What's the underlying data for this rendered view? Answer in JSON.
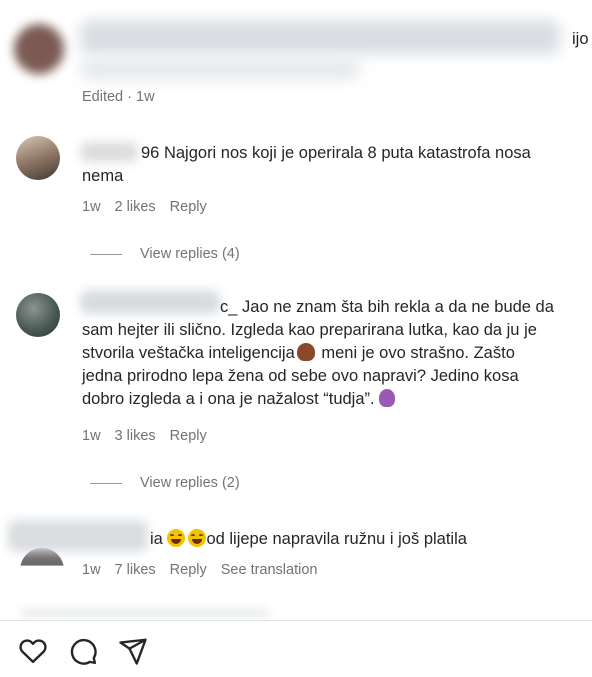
{
  "top_comment": {
    "partial_text": "ijo",
    "meta": "Edited · 1w"
  },
  "comments": [
    {
      "username_suffix": "96",
      "text": "Najgori nos koji je operirala 8 puta katastrofa nosa nema",
      "line1": "Najgori nos koji je operirala 8 puta katastrofa nosa",
      "line2": "nema",
      "time": "1w",
      "likes": "2 likes",
      "reply": "Reply",
      "view_replies": "View replies (4)"
    },
    {
      "username_suffix": "c_",
      "line1": "Jao ne znam šta bih rekla a da ne bude da",
      "line2": "sam hejter ili slično. Izgleda kao preparirana lutka, kao da ju je",
      "line3a": "stvorila veštačka inteligencija",
      "line3b": " meni je ovo strašno. Zašto",
      "line4": "jedna prirodno lepa žena od sebe ovo napravi? Jedino kosa",
      "line5": "dobro izgleda a i ona je nažalost “tudja”.",
      "time": "1w",
      "likes": "3 likes",
      "reply": "Reply",
      "view_replies": "View replies (2)"
    },
    {
      "username_suffix": "ia",
      "text": "od lijepe napravila ružnu i još platila",
      "time": "1w",
      "likes": "7 likes",
      "reply": "Reply",
      "see_translation": "See translation"
    }
  ],
  "icons": [
    "heart-icon",
    "comment-icon",
    "share-icon"
  ],
  "colors": {
    "text": "#262626",
    "muted": "#737373",
    "background": "#ffffff"
  }
}
